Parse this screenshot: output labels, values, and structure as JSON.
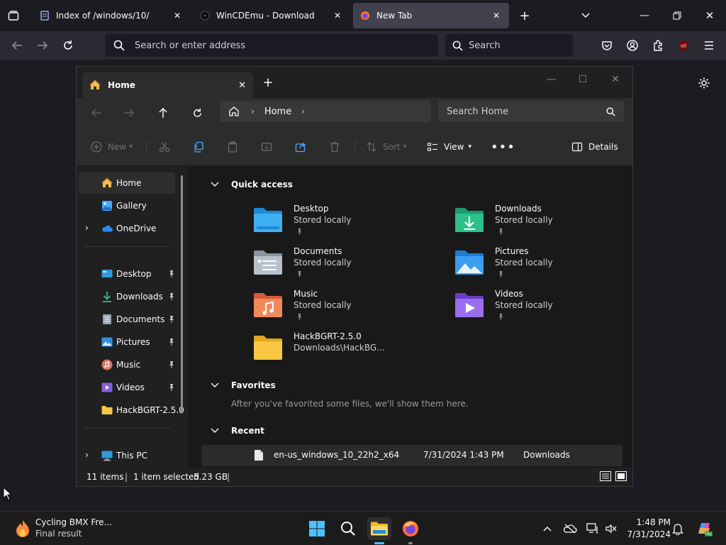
{
  "browser": {
    "tabs": [
      {
        "label": "Index of /windows/10/",
        "icon": "document-favicon"
      },
      {
        "label": "WinCDEmu - Download",
        "icon": "wincdemu-favicon"
      },
      {
        "label": "New Tab",
        "icon": "firefox-favicon"
      }
    ],
    "new_tab_icon": "plus-icon",
    "url_placeholder": "Search or enter address",
    "search_placeholder": "Search"
  },
  "explorer": {
    "tab_title": "Home",
    "breadcrumb": [
      "Home"
    ],
    "search_placeholder": "Search Home",
    "toolbar": {
      "new_label": "New",
      "sort_label": "Sort",
      "view_label": "View",
      "details_label": "Details"
    },
    "nav": {
      "top": [
        {
          "label": "Home",
          "icon": "home-icon"
        },
        {
          "label": "Gallery",
          "icon": "gallery-icon"
        },
        {
          "label": "OneDrive",
          "icon": "onedrive-icon"
        }
      ],
      "pinned": [
        {
          "label": "Desktop",
          "icon": "desktop-icon"
        },
        {
          "label": "Downloads",
          "icon": "downloads-icon"
        },
        {
          "label": "Documents",
          "icon": "documents-icon"
        },
        {
          "label": "Pictures",
          "icon": "pictures-icon"
        },
        {
          "label": "Music",
          "icon": "music-icon"
        },
        {
          "label": "Videos",
          "icon": "videos-icon"
        },
        {
          "label": "HackBGRT-2.5.0",
          "icon": "folder-icon"
        }
      ],
      "bottom": [
        {
          "label": "This PC",
          "icon": "this-pc-icon"
        }
      ]
    },
    "quick_access": {
      "heading": "Quick access",
      "items": [
        {
          "name": "Desktop",
          "sub": "Stored locally",
          "icon": "desktop-folder-icon"
        },
        {
          "name": "Downloads",
          "sub": "Stored locally",
          "icon": "downloads-folder-icon"
        },
        {
          "name": "Documents",
          "sub": "Stored locally",
          "icon": "documents-folder-icon"
        },
        {
          "name": "Pictures",
          "sub": "Stored locally",
          "icon": "pictures-folder-icon"
        },
        {
          "name": "Music",
          "sub": "Stored locally",
          "icon": "music-folder-icon"
        },
        {
          "name": "Videos",
          "sub": "Stored locally",
          "icon": "videos-folder-icon"
        },
        {
          "name": "HackBGRT-2.5.0",
          "sub": "Downloads\\HackBG...",
          "icon": "folder-icon"
        }
      ]
    },
    "favorites": {
      "heading": "Favorites",
      "empty_text": "After you've favorited some files, we'll show them here."
    },
    "recent": {
      "heading": "Recent",
      "rows": [
        {
          "name": "en-us_windows_10_22h2_x64",
          "date": "7/31/2024 1:43 PM",
          "location": "Downloads"
        }
      ]
    },
    "status": {
      "count": "11 items",
      "selection": "1 item selected",
      "size": "5.23 GB"
    }
  },
  "taskbar": {
    "widget_title": "Cycling BMX Fre...",
    "widget_sub": "Final result",
    "time": "1:48 PM",
    "date": "7/31/2024"
  },
  "colors": {
    "accent_blue": "#4aa8ff",
    "folder_yellow": "#f8c843",
    "ublock_red": "#800000"
  }
}
